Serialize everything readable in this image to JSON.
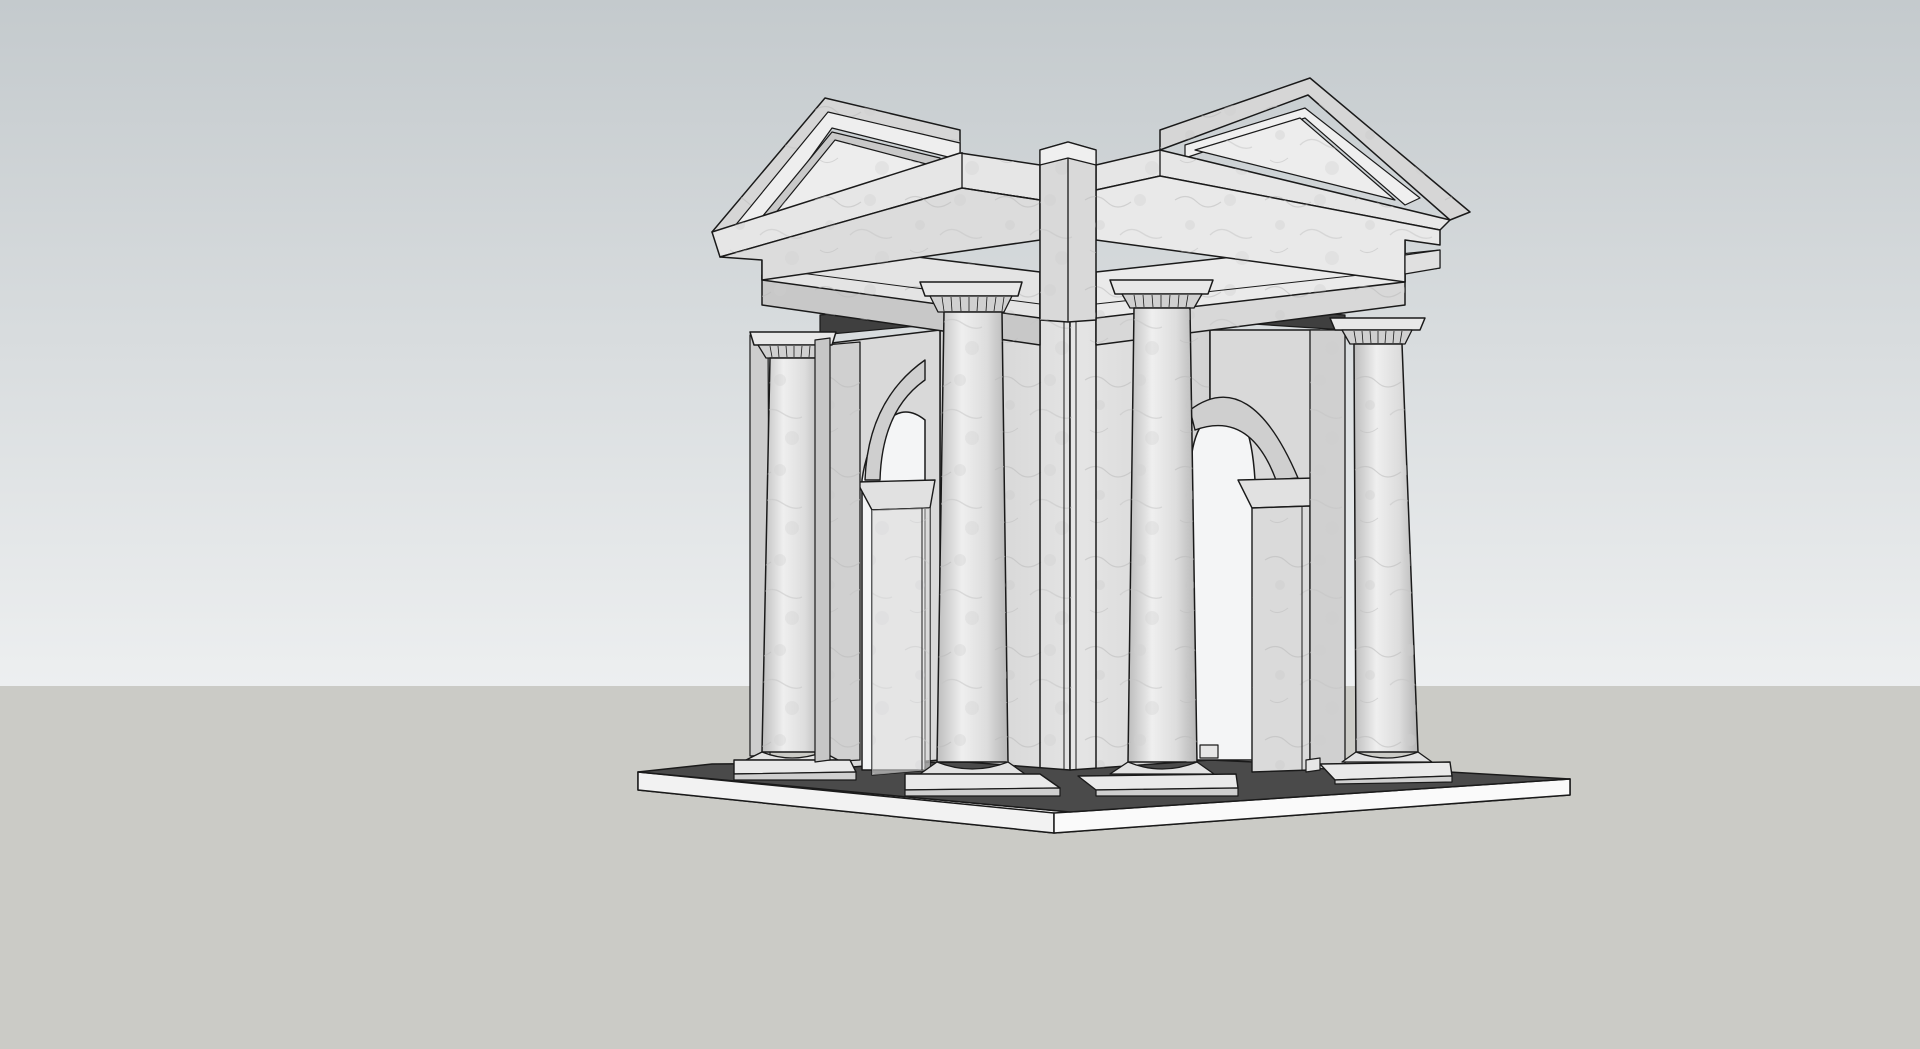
{
  "viewport": {
    "type": "3d-model-view",
    "style": "hidden-line-with-textures",
    "sky_top_color": "#C4CACD",
    "sky_bottom_color": "#EDEFF0",
    "ground_color": "#CBCBC6",
    "edge_color": "#1A1A1A",
    "marble_light": "#EBEBEB",
    "marble_mid": "#DADADA",
    "marble_shadow": "#C2C2C2",
    "floor_color": "#4A4A4A",
    "base_slab_color": "#FFFFFF"
  },
  "model": {
    "subject": "classical-pavilion",
    "columns_visible": 4,
    "arches_visible": 2,
    "pediments_visible": 2
  }
}
